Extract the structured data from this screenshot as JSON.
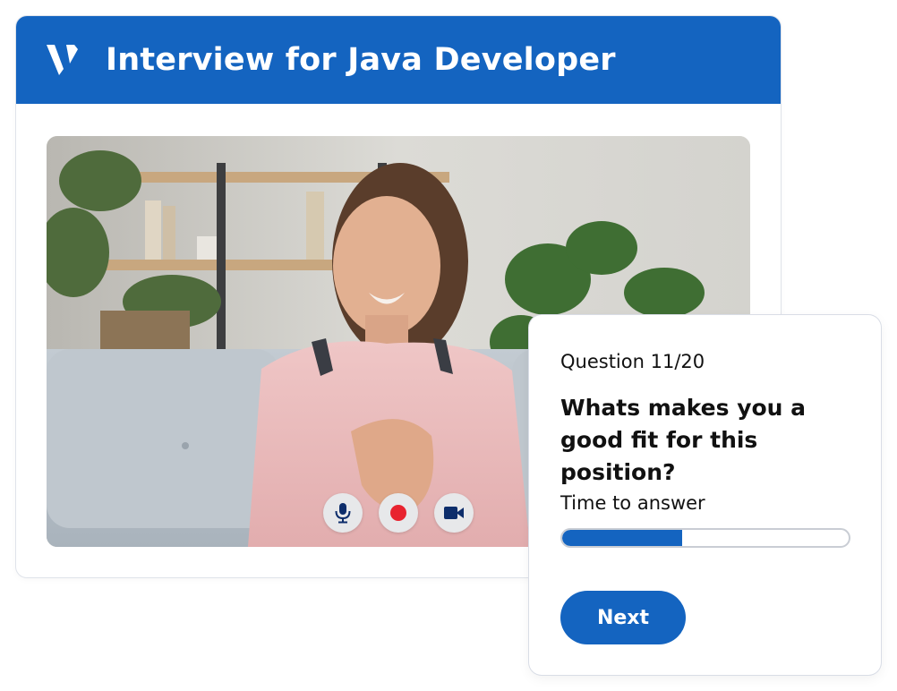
{
  "header": {
    "title": "Interview for Java Developer",
    "logo_icon": "v-logo-icon"
  },
  "video": {
    "controls": [
      {
        "icon": "microphone-icon",
        "color": "#0d2d6b"
      },
      {
        "icon": "record-icon",
        "color": "#e8232f"
      },
      {
        "icon": "video-camera-icon",
        "color": "#0d2d6b"
      }
    ]
  },
  "question": {
    "counter": "Question 11/20",
    "text": "Whats makes you a good fit for this position?",
    "timer_label": "Time to answer",
    "time_progress": 0.42,
    "next_label": "Next"
  },
  "colors": {
    "brand": "#1464c0",
    "record": "#e8232f"
  }
}
